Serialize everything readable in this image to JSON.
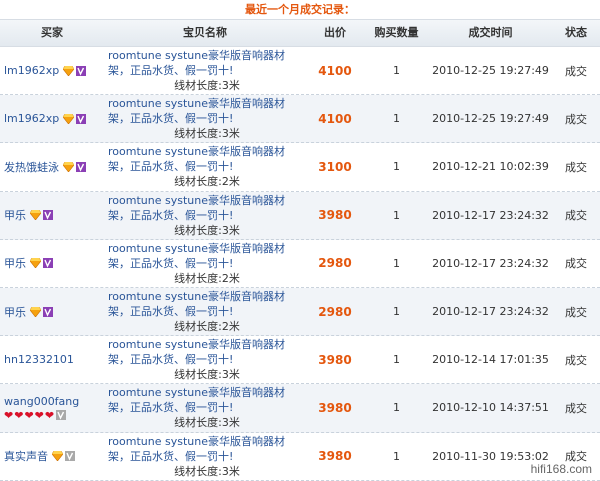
{
  "title": "最近一个月成交记录：",
  "headers": {
    "buyer": "买家",
    "item": "宝贝名称",
    "price": "出价",
    "quantity": "购买数量",
    "time": "成交时间",
    "status": "状态"
  },
  "colors": {
    "accent": "#e4570e",
    "link": "#2a5598",
    "stripe": "#f1f4f8"
  },
  "rows": [
    {
      "buyer": "lm1962xp",
      "hearts": 0,
      "badge_gray": false,
      "item": "roomtune systune豪华版音响器材架，正品水货、假一罚十!",
      "spec": "线材长度:3米",
      "price": "4100",
      "qty": "1",
      "time": "2010-12-25 19:27:49",
      "status": "成交"
    },
    {
      "buyer": "lm1962xp",
      "hearts": 0,
      "badge_gray": false,
      "item": "roomtune systune豪华版音响器材架，正品水货、假一罚十!",
      "spec": "线材长度:3米",
      "price": "4100",
      "qty": "1",
      "time": "2010-12-25 19:27:49",
      "status": "成交"
    },
    {
      "buyer": "发热饿蛙泳",
      "hearts": 0,
      "badge_gray": false,
      "item": "roomtune systune豪华版音响器材架，正品水货、假一罚十!",
      "spec": "线材长度:2米",
      "price": "3100",
      "qty": "1",
      "time": "2010-12-21 10:02:39",
      "status": "成交"
    },
    {
      "buyer": "甲乐",
      "hearts": 0,
      "badge_gray": false,
      "item": "roomtune systune豪华版音响器材架，正品水货、假一罚十!",
      "spec": "线材长度:3米",
      "price": "3980",
      "qty": "1",
      "time": "2010-12-17 23:24:32",
      "status": "成交"
    },
    {
      "buyer": "甲乐",
      "hearts": 0,
      "badge_gray": false,
      "item": "roomtune systune豪华版音响器材架，正品水货、假一罚十!",
      "spec": "线材长度:2米",
      "price": "2980",
      "qty": "1",
      "time": "2010-12-17 23:24:32",
      "status": "成交"
    },
    {
      "buyer": "甲乐",
      "hearts": 0,
      "badge_gray": false,
      "item": "roomtune systune豪华版音响器材架，正品水货、假一罚十!",
      "spec": "线材长度:2米",
      "price": "2980",
      "qty": "1",
      "time": "2010-12-17 23:24:32",
      "status": "成交"
    },
    {
      "buyer": "hn12332101",
      "hearts": 0,
      "badge_gray": false,
      "no_icons": true,
      "item": "roomtune systune豪华版音响器材架，正品水货、假一罚十!",
      "spec": "线材长度:3米",
      "price": "3980",
      "qty": "1",
      "time": "2010-12-14 17:01:35",
      "status": "成交"
    },
    {
      "buyer": "wang000fang",
      "hearts": 5,
      "badge_gray": true,
      "item": "roomtune systune豪华版音响器材架，正品水货、假一罚十!",
      "spec": "线材长度:3米",
      "price": "3980",
      "qty": "1",
      "time": "2010-12-10 14:37:51",
      "status": "成交"
    },
    {
      "buyer": "真实声音",
      "hearts": 0,
      "badge_gray": true,
      "item": "roomtune systune豪华版音响器材架，正品水货、假一罚十!",
      "spec": "线材长度:3米",
      "price": "3980",
      "qty": "1",
      "time": "2010-11-30 19:53:02",
      "status": "成交"
    }
  ],
  "watermark": "hifi168.com"
}
